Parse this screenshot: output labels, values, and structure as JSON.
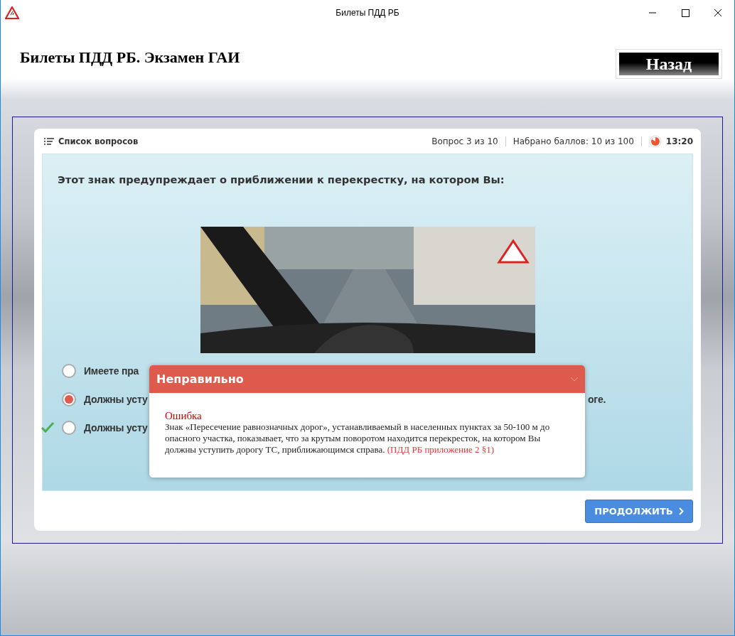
{
  "window": {
    "title": "Билеты ПДД РБ"
  },
  "header": {
    "title": "Билеты ПДД РБ. Экзамен ГАИ",
    "back_button": "Назад"
  },
  "toolbar": {
    "question_list": "Список вопросов",
    "progress": "Вопрос 3 из 10",
    "score": "Набрано баллов: 10 из 100",
    "timer": "13:20"
  },
  "question": {
    "text": "Этот знак предупреждает о приближении к перекрестку, на котором Вы:",
    "answers": [
      {
        "text": "Имеете пра",
        "selected": false,
        "correct": false
      },
      {
        "text": "Должны усту",
        "tail": "оге.",
        "selected": true,
        "correct": false
      },
      {
        "text": "Должны усту",
        "selected": false,
        "correct": true
      }
    ]
  },
  "popup": {
    "title": "Неправильно",
    "heading": "Ошибка",
    "body": "Знак «Пересечение равнозначных дорог», устанавливаемый в населенных пунктах за 50-100 м до опасного участка, показывает, что за крутым поворотом находится перекресток, на котором Вы должны уступить дорогу ТС, приближающимся справа.",
    "reference": "(ПДД РБ приложение 2 §1)"
  },
  "continue_button": "ПРОДОЛЖИТЬ"
}
